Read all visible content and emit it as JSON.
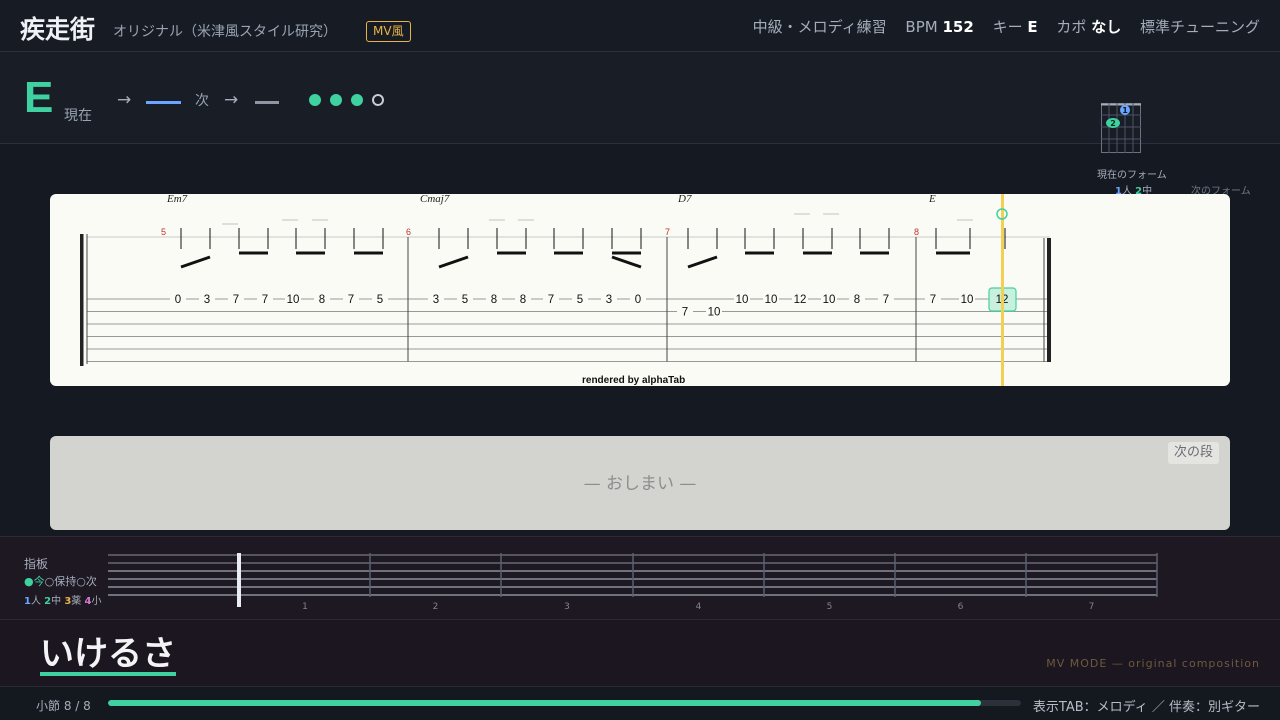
{
  "header": {
    "title": "疾走街",
    "subtitle": "オリジナル（米津風スタイル研究）",
    "badge": "MV風",
    "level": "中級・メロディ練習",
    "bpm_label": "BPM",
    "bpm_value": "152",
    "key_label": "キー",
    "key_value": "E",
    "capo_label": "カポ",
    "capo_value": "なし",
    "tuning": "標準チューニング"
  },
  "status": {
    "current_chord": "E",
    "current_label": "現在",
    "next_label": "次",
    "arrow": "→",
    "beats_total": 4,
    "beats_filled": 3,
    "form_current_label": "現在のフォーム",
    "form_fingers": [
      "1",
      "人",
      "2",
      "中"
    ],
    "form_next_label": "次のフォーム",
    "chord_diagram": {
      "finger1": "1",
      "finger2": "2"
    },
    "colors": {
      "accent": "#3fd1a0",
      "next": "#6aa5ff",
      "next2": "#8e95a3"
    }
  },
  "tab": {
    "render_note": "rendered by alphaTab",
    "measures": [
      {
        "number": "5",
        "chord": "Em7",
        "notes": [
          {
            "fret": "0",
            "string": 3
          },
          {
            "fret": "3",
            "string": 3
          },
          {
            "fret": "7",
            "string": 3
          },
          {
            "fret": "7",
            "string": 3
          },
          {
            "fret": "10",
            "string": 3
          },
          {
            "fret": "8",
            "string": 3
          },
          {
            "fret": "7",
            "string": 3
          },
          {
            "fret": "5",
            "string": 3
          }
        ]
      },
      {
        "number": "6",
        "chord": "Cmaj7",
        "notes": [
          {
            "fret": "3",
            "string": 3
          },
          {
            "fret": "5",
            "string": 3
          },
          {
            "fret": "8",
            "string": 3
          },
          {
            "fret": "8",
            "string": 3
          },
          {
            "fret": "7",
            "string": 3
          },
          {
            "fret": "5",
            "string": 3
          },
          {
            "fret": "3",
            "string": 3
          },
          {
            "fret": "0",
            "string": 3
          }
        ]
      },
      {
        "number": "7",
        "chord": "D7",
        "notes": [
          {
            "fret": "7",
            "string": 4
          },
          {
            "fret": "10",
            "string": 4
          },
          {
            "fret": "10",
            "string": 3
          },
          {
            "fret": "10",
            "string": 3
          },
          {
            "fret": "12",
            "string": 3
          },
          {
            "fret": "10",
            "string": 3
          },
          {
            "fret": "8",
            "string": 3
          },
          {
            "fret": "7",
            "string": 3
          }
        ]
      },
      {
        "number": "8",
        "chord": "E",
        "notes": [
          {
            "fret": "7",
            "string": 3
          },
          {
            "fret": "10",
            "string": 3
          },
          {
            "fret": "12",
            "string": 3
          }
        ]
      }
    ],
    "active_note": "12"
  },
  "next_section": {
    "end_text": "— おしまい —",
    "next_button": "次の段"
  },
  "fretboard": {
    "title": "指板",
    "legend": [
      "●今",
      "○保持",
      "○次"
    ],
    "fingers": [
      {
        "num": "1",
        "name": "人"
      },
      {
        "num": "2",
        "name": "中"
      },
      {
        "num": "3",
        "name": "薬"
      },
      {
        "num": "4",
        "name": "小"
      }
    ],
    "fret_numbers": [
      "1",
      "2",
      "3",
      "4",
      "5",
      "6",
      "7"
    ]
  },
  "lyric": {
    "text": "いけるさ",
    "mv_mode": "MV MODE — original composition"
  },
  "footer": {
    "measure_label": "小節 8 / 8",
    "progress": 0.956,
    "display_note": "表示TAB：メロディ ／ 伴奏：別ギター"
  }
}
